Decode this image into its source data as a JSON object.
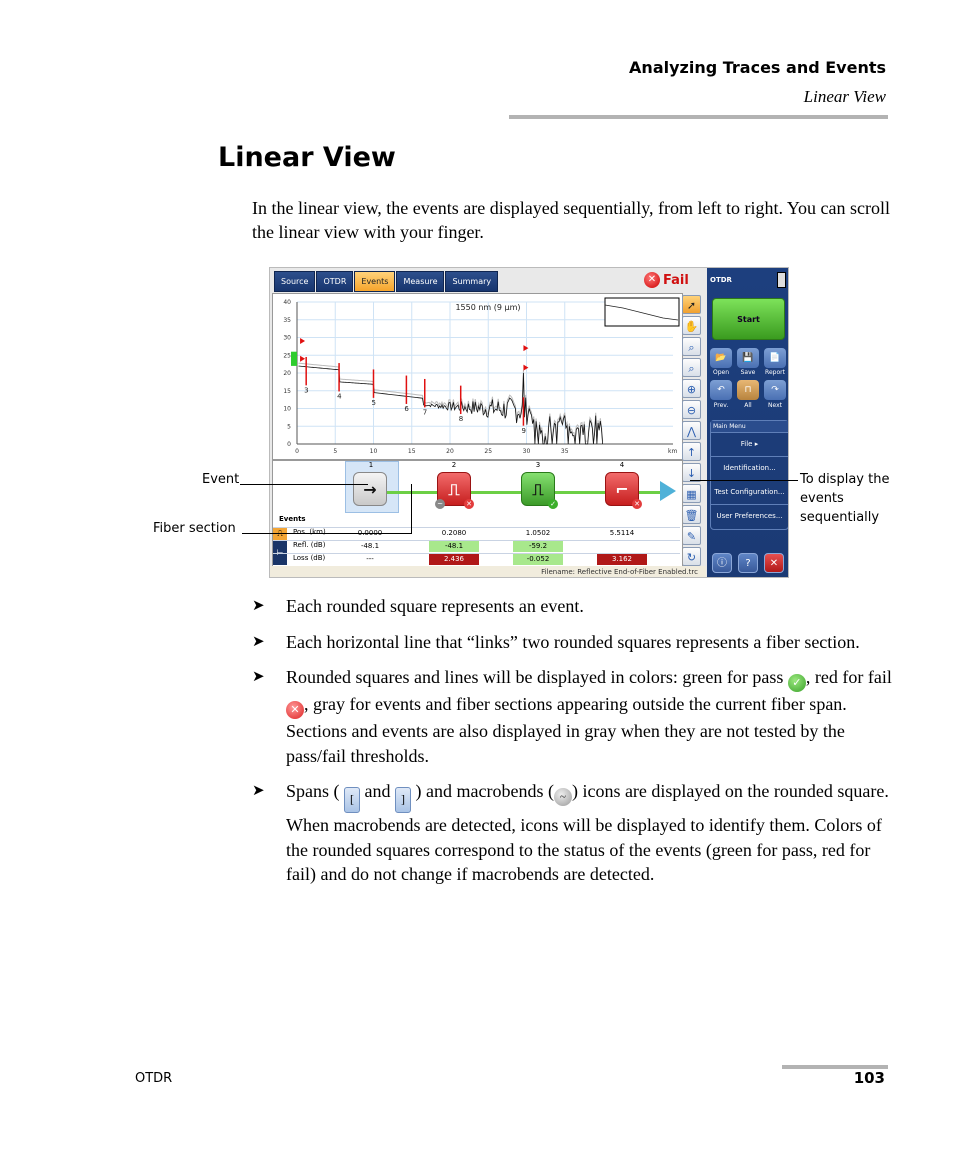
{
  "header": {
    "chapter": "Analyzing Traces and Events",
    "section": "Linear View"
  },
  "page_title": "Linear View",
  "intro": "In the linear view, the events are displayed sequentially, from left to right. You can scroll the linear view with your finger.",
  "figure": {
    "tabs": [
      {
        "label": "Source",
        "active": false
      },
      {
        "label": "OTDR",
        "active": false
      },
      {
        "label": "Events",
        "active": true
      },
      {
        "label": "Measure",
        "active": false
      },
      {
        "label": "Summary",
        "active": false
      }
    ],
    "status": "Fail",
    "trace_title": "1550 nm (9 µm)",
    "x_unit": "km",
    "y_ticks": [
      "40",
      "35",
      "30",
      "25",
      "20",
      "15",
      "10",
      "5",
      "0"
    ],
    "x_ticks": [
      "0",
      "5",
      "10",
      "15",
      "20",
      "25",
      "30",
      "35"
    ],
    "trace_markers": [
      "3",
      "4",
      "5",
      "6",
      "7",
      "8",
      "9"
    ],
    "linear_view": {
      "events": [
        {
          "number": "1",
          "status": "gray",
          "icon": "span-start"
        },
        {
          "number": "2",
          "status": "red",
          "icon": "reflective",
          "macrobend": true
        },
        {
          "number": "3",
          "status": "green",
          "icon": "reflective"
        },
        {
          "number": "4",
          "status": "red",
          "icon": "loss"
        }
      ],
      "events_label": "Events",
      "rows": [
        {
          "label": "Pos. (km)",
          "values": [
            "0.0000",
            "0.2080",
            "1.0502",
            "5.5114"
          ],
          "status": [
            "",
            "",
            "",
            ""
          ]
        },
        {
          "label": "Refl. (dB)",
          "values": [
            "-48.1",
            "-48.1",
            "-59.2",
            ""
          ],
          "status": [
            "",
            "pass",
            "pass",
            ""
          ]
        },
        {
          "label": "Loss (dB)",
          "values": [
            "---",
            "2.436",
            "-0.052",
            "3.162"
          ],
          "status": [
            "",
            "fail",
            "pass",
            "fail"
          ]
        }
      ]
    },
    "filename": "Filename: Reflective End-of-Fiber Enabled.trc",
    "side_panel": {
      "title": "OTDR",
      "start": "Start",
      "buttons": [
        "Open",
        "Save",
        "Report"
      ],
      "nav": [
        "Prev.",
        "All",
        "Next"
      ],
      "menu_header": "Main Menu",
      "menu_items": [
        "File",
        "Identification...",
        "Test Configuration...",
        "User Preferences..."
      ]
    },
    "callouts": {
      "event": "Event",
      "fiber_section": "Fiber section",
      "sequential": "To display the events sequentially"
    }
  },
  "bullets": [
    "Each rounded square represents an event.",
    "Each horizontal line that “links” two rounded squares represents a fiber section."
  ],
  "bullet3": {
    "a": "Rounded squares and lines will be displayed in colors: green for pass ",
    "b": ", red for fail ",
    "c": ", gray for events and fiber sections appearing outside the current fiber span. Sections and events are also displayed in gray when they are not tested by the pass/fail thresholds."
  },
  "bullet4": {
    "a": "Spans (",
    "b": " and ",
    "c": ") and macrobends (",
    "d": ") icons are displayed on the rounded square. When macrobends are detected, icons will be displayed to identify them. Colors of the rounded squares correspond to the status of the events (green for pass, red for fail) and do not change if macrobends are detected."
  },
  "footer": {
    "left": "OTDR",
    "page": "103"
  }
}
